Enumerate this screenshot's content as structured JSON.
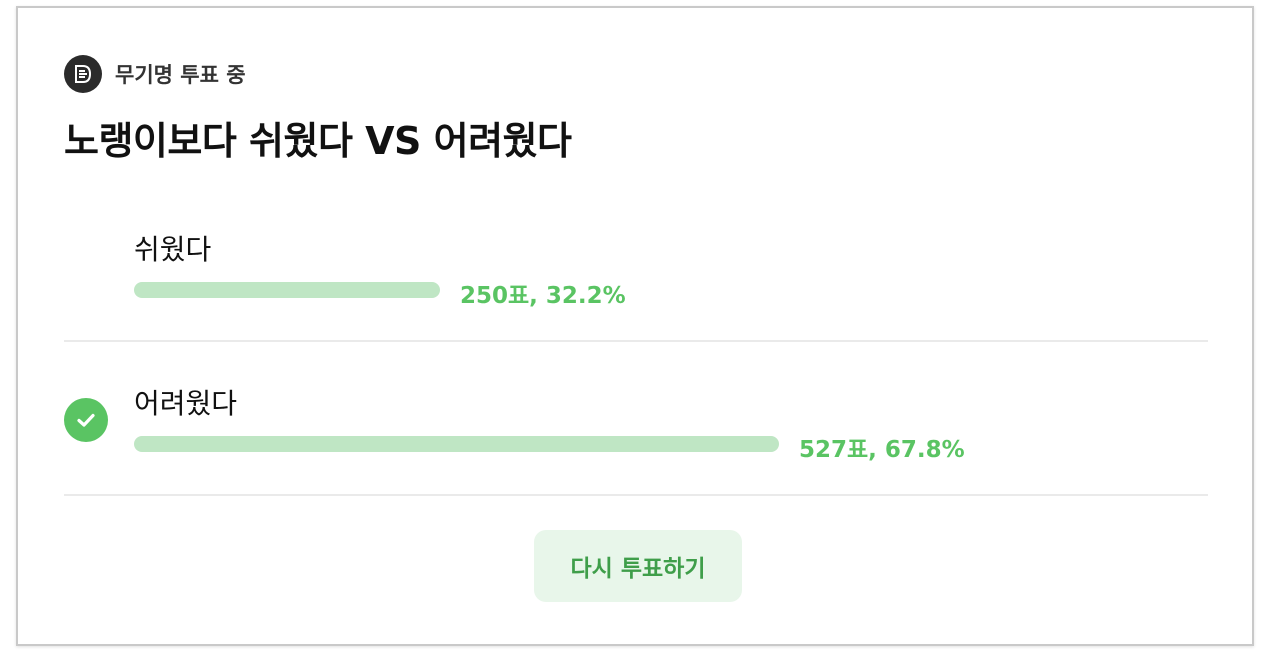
{
  "poll": {
    "status_icon": "poll-list-icon",
    "status_text": "무기명 투표 중",
    "title": "노랭이보다 쉬웠다 VS 어려웠다",
    "options": [
      {
        "label": "쉬웠다",
        "result_text": "250표, 32.2%",
        "votes": 250,
        "percent": 32.2,
        "selected": false
      },
      {
        "label": "어려웠다",
        "result_text": "527표, 67.8%",
        "votes": 527,
        "percent": 67.8,
        "selected": true,
        "selected_icon": "check-circle-icon"
      }
    ],
    "revote_label": "다시 투표하기"
  },
  "colors": {
    "accent_green": "#5ac463",
    "bar_green": "#bfe6c4",
    "button_bg": "#e8f6ea",
    "button_text": "#3f9e4a",
    "status_icon_bg": "#2b2b2b"
  }
}
